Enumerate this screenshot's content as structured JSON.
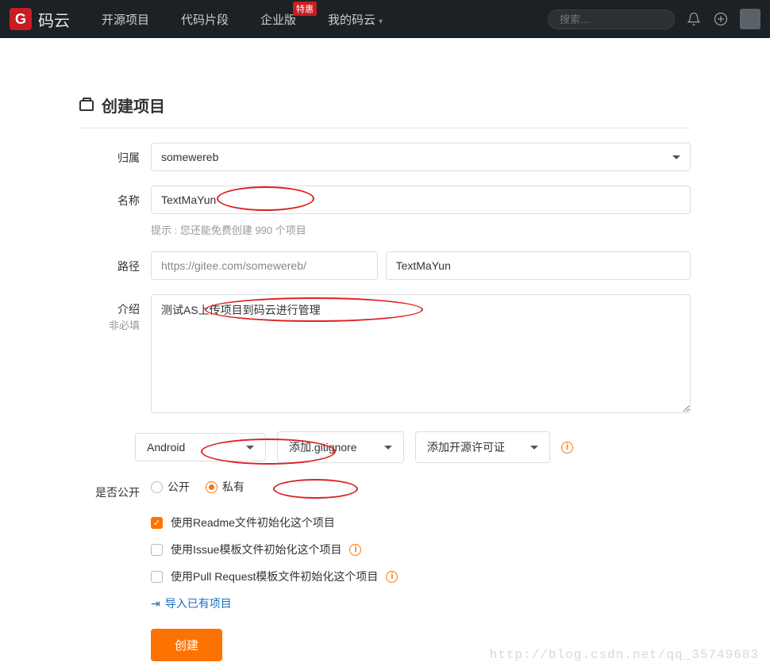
{
  "header": {
    "logo_text": "码云",
    "nav": {
      "opensource": "开源项目",
      "snippets": "代码片段",
      "enterprise": "企业版",
      "enterprise_badge": "特惠",
      "my": "我的码云"
    },
    "search_placeholder": "搜索…"
  },
  "page": {
    "title": "创建项目"
  },
  "form": {
    "labels": {
      "owner": "归属",
      "name": "名称",
      "path": "路径",
      "intro": "介绍",
      "intro_sublabel": "非必填",
      "public": "是否公开"
    },
    "owner_value": "somewereb",
    "name_value": "TextMaYun",
    "name_hint": "提示 : 您还能免费创建 990 个项目",
    "path_prefix": "https://gitee.com/somewereb/",
    "path_value": "TextMaYun",
    "intro_value": "测试AS上传项目到码云进行管理",
    "selects": {
      "language": "Android",
      "gitignore": "添加.gitignore",
      "license": "添加开源许可证"
    },
    "visibility": {
      "public": "公开",
      "private": "私有"
    },
    "checks": {
      "readme": "使用Readme文件初始化这个项目",
      "issue": "使用Issue模板文件初始化这个项目",
      "pr": "使用Pull Request模板文件初始化这个项目"
    },
    "import_link": "导入已有项目",
    "submit": "创建"
  },
  "watermark": "http://blog.csdn.net/qq_35749683"
}
